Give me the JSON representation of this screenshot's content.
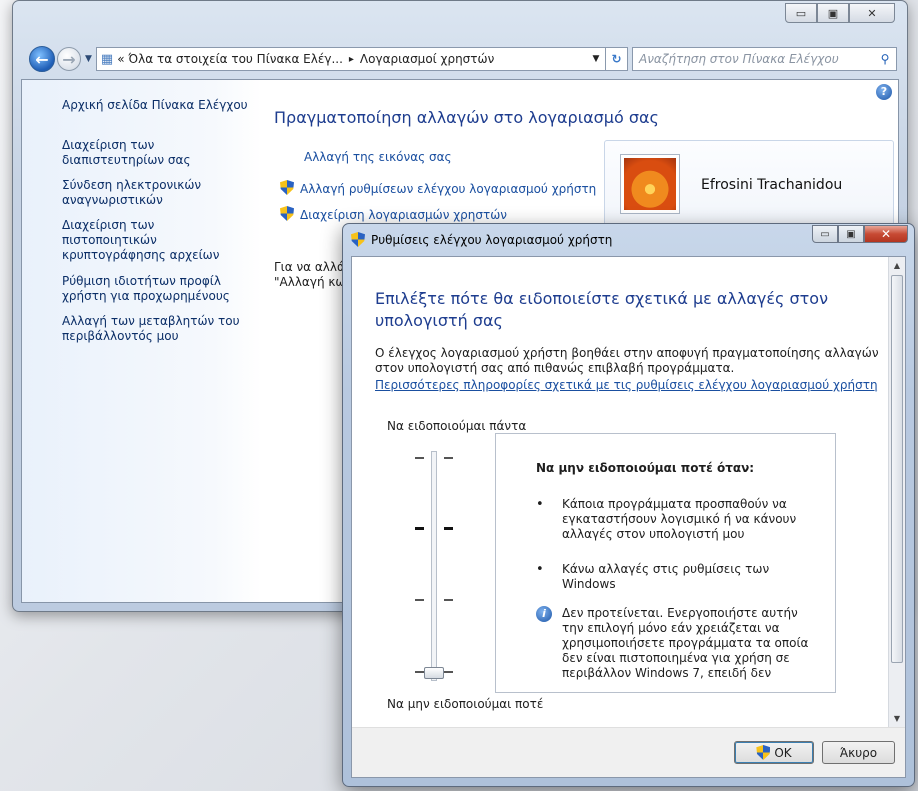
{
  "control_panel": {
    "caption_buttons": {
      "minimize": "▭",
      "maximize": "▣",
      "close": "✕"
    },
    "address_path": {
      "prefix": "«",
      "crumb1": "Όλα τα στοιχεία του Πίνακα Ελέγ...",
      "separator": "▸",
      "crumb2": "Λογαριασμοί χρηστών"
    },
    "search_placeholder": "Αναζήτηση στον Πίνακα Ελέγχου",
    "sidebar": {
      "home": "Αρχική σελίδα Πίνακα Ελέγχου",
      "items": [
        "Διαχείριση των διαπιστευτηρίων σας",
        "Σύνδεση ηλεκτρονικών αναγνωριστικών",
        "Διαχείριση των πιστοποιητικών κρυπτογράφησης αρχείων",
        "Ρύθμιση ιδιοτήτων προφίλ χρήστη για προχωρημένους",
        "Αλλαγή των μεταβλητών του περιβάλλοντός μου"
      ]
    },
    "main": {
      "title": "Πραγματοποίηση αλλαγών στο λογαριασμό σας",
      "link_picture": "Αλλαγή της εικόνας σας",
      "link_uac": "Αλλαγή ρυθμίσεων ελέγχου λογαριασμού χρήστη",
      "link_manage": "Διαχείριση λογαριασμών χρηστών",
      "fragment_line1": "Για να αλλά",
      "fragment_line2": "\"Αλλαγή κω"
    },
    "user_name": "Efrosini Trachanidou"
  },
  "uac_dialog": {
    "title": "Ρυθμίσεις ελέγχου λογαριασμού χρήστη",
    "heading": "Επιλέξτε πότε θα ειδοποιείστε σχετικά με αλλαγές στον υπολογιστή σας",
    "description": "Ο έλεγχος λογαριασμού χρήστη βοηθάει στην αποφυγή πραγματοποίησης αλλαγών στον υπολογιστή σας από πιθανώς επιβλαβή προγράμματα.",
    "more_info_link": "Περισσότερες πληροφορίες σχετικά με τις ρυθμίσεις ελέγχου λογαριασμού χρήστη",
    "slider": {
      "label_top": "Να ειδοποιούμαι πάντα",
      "label_bottom": "Να μην ειδοποιούμαι ποτέ",
      "levels": 4,
      "selected_level": 1
    },
    "info": {
      "heading": "Να μην ειδοποιούμαι ποτέ όταν:",
      "bullet_glyph": "•",
      "bullet1": "Κάποια προγράμματα προσπαθούν να εγκαταστήσουν λογισμικό ή να κάνουν αλλαγές στον υπολογιστή μου",
      "bullet2": "Κάνω αλλαγές στις ρυθμίσεις των Windows",
      "warning": "Δεν προτείνεται. Ενεργοποιήστε αυτήν την επιλογή μόνο εάν χρειάζεται να χρησιμοποιήσετε προγράμματα τα οποία δεν είναι πιστοποιημένα για χρήση σε περιβάλλον Windows 7, επειδή δεν"
    },
    "buttons": {
      "ok": "OK",
      "cancel": "Άκυρο"
    }
  },
  "colors": {
    "link": "#1a4fa0",
    "heading": "#1e3d8f",
    "window_frame": "#bccbe0",
    "close_red": "#c74a34"
  }
}
